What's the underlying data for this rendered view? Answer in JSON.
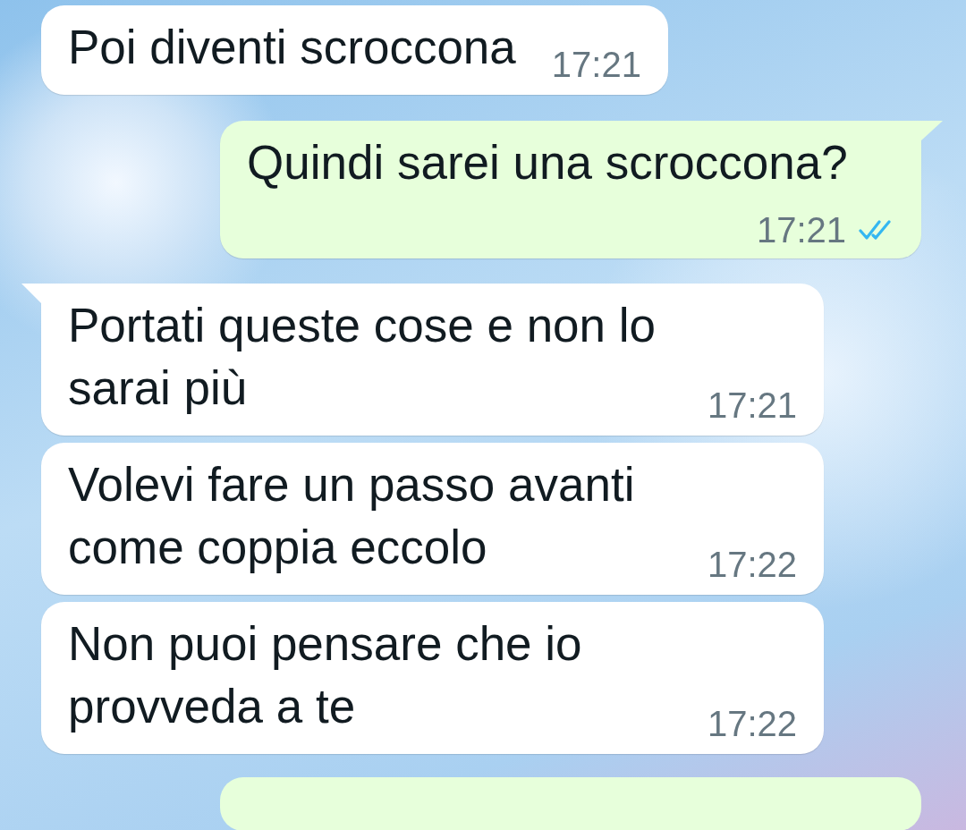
{
  "messages": [
    {
      "kind": "incoming",
      "tail": false,
      "text": "Poi diventi scroccona",
      "time": "17:21"
    },
    {
      "kind": "outgoing",
      "tail": true,
      "text": "Quindi sarei una scroccona?",
      "time": "17:21",
      "read": true
    },
    {
      "kind": "incoming",
      "tail": true,
      "text": "Portati queste cose e non lo sarai più",
      "time": "17:21"
    },
    {
      "kind": "incoming",
      "tail": false,
      "text": "Volevi fare un passo avanti come coppia eccolo",
      "time": "17:22"
    },
    {
      "kind": "incoming",
      "tail": false,
      "text": "Non puoi pensare che io provveda a te",
      "time": "17:22"
    }
  ]
}
